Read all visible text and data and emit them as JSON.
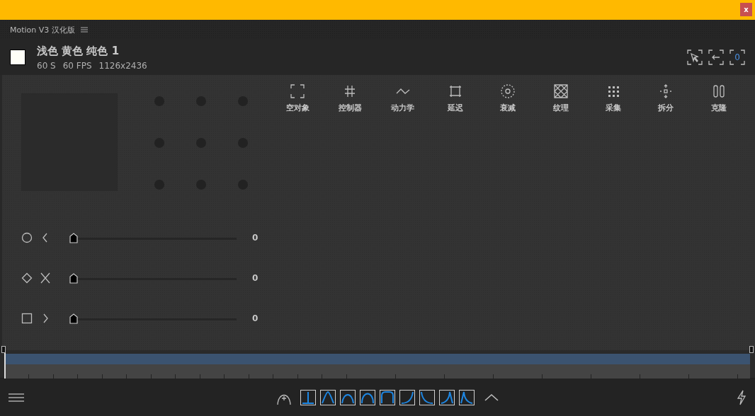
{
  "top_bar": {
    "close_label": "x"
  },
  "app": {
    "title": "Motion V3 汉化版"
  },
  "composition": {
    "name": "浅色 黄色 纯色 1",
    "duration": "60 S",
    "fps": "60 FPS",
    "size": "1126x2436"
  },
  "header_tools": [
    {
      "kind": "pointer"
    },
    {
      "kind": "arrow"
    },
    {
      "kind": "counter",
      "label": "0"
    }
  ],
  "tools": [
    {
      "kind": "null",
      "label": "空对象"
    },
    {
      "kind": "controller",
      "label": "控制器"
    },
    {
      "kind": "dynamics",
      "label": "动力学"
    },
    {
      "kind": "lag",
      "label": "延迟"
    },
    {
      "kind": "falloff",
      "label": "衰减"
    },
    {
      "kind": "texture",
      "label": "纹理"
    },
    {
      "kind": "collect",
      "label": "采集"
    },
    {
      "kind": "split",
      "label": "拆分"
    },
    {
      "kind": "clone",
      "label": "克隆"
    }
  ],
  "sliders": [
    {
      "kind": "circle",
      "level": 0,
      "value": "0"
    },
    {
      "kind": "diamond",
      "level": 0,
      "value": "0"
    },
    {
      "kind": "square",
      "level": 0,
      "value": "0"
    }
  ],
  "timeline": {
    "level": 1
  },
  "easings": [
    {
      "kind": "hold"
    },
    {
      "kind": "peak"
    },
    {
      "kind": "arch"
    },
    {
      "kind": "round"
    },
    {
      "kind": "plateau"
    },
    {
      "kind": "ease-in"
    },
    {
      "kind": "ease-out"
    },
    {
      "kind": "peak-late"
    },
    {
      "kind": "peak-early"
    }
  ]
}
